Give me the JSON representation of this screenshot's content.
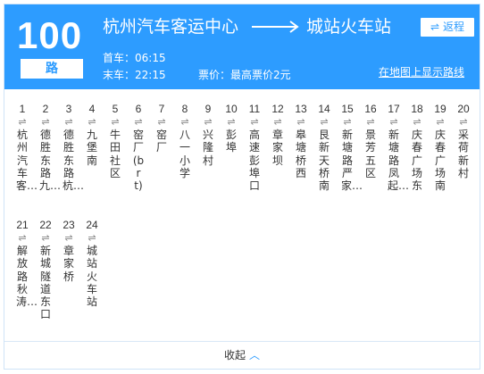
{
  "route": {
    "number": "100",
    "unit": "路",
    "from": "杭州汽车客运中心",
    "to": "城站火车站",
    "return_label": "返程",
    "return_icon": "swap-arrows-icon",
    "first_bus": "首车：06:15",
    "last_bus": "末车：22:15",
    "fare": "票价：最高票价2元",
    "map_link": "在地图上显示路线"
  },
  "stops": [
    {
      "num": "1",
      "name": "杭州汽车客…"
    },
    {
      "num": "2",
      "name": "德胜东路九…"
    },
    {
      "num": "3",
      "name": "德胜东路杭…"
    },
    {
      "num": "4",
      "name": "九堡南"
    },
    {
      "num": "5",
      "name": "牛田社区"
    },
    {
      "num": "6",
      "name": "窑厂(brt)"
    },
    {
      "num": "7",
      "name": "窑厂"
    },
    {
      "num": "8",
      "name": "八一小学"
    },
    {
      "num": "9",
      "name": "兴隆村"
    },
    {
      "num": "10",
      "name": "彭埠"
    },
    {
      "num": "11",
      "name": "高速彭埠口"
    },
    {
      "num": "12",
      "name": "章家坝"
    },
    {
      "num": "13",
      "name": "皋塘桥西"
    },
    {
      "num": "14",
      "name": "艮新天桥南"
    },
    {
      "num": "15",
      "name": "新塘路严家…"
    },
    {
      "num": "16",
      "name": "景芳五区"
    },
    {
      "num": "17",
      "name": "新塘路凤起…"
    },
    {
      "num": "18",
      "name": "庆春广场东"
    },
    {
      "num": "19",
      "name": "庆春广场南"
    },
    {
      "num": "20",
      "name": "采荷新村"
    },
    {
      "num": "21",
      "name": "解放路秋涛…"
    },
    {
      "num": "22",
      "name": "新城隧道东口"
    },
    {
      "num": "23",
      "name": "章家桥"
    },
    {
      "num": "24",
      "name": "城站火车站"
    }
  ],
  "exchange_glyph": "⇌",
  "collapse_label": "收起",
  "colors": {
    "accent": "#2d9cff",
    "border": "#cfe3f7"
  }
}
